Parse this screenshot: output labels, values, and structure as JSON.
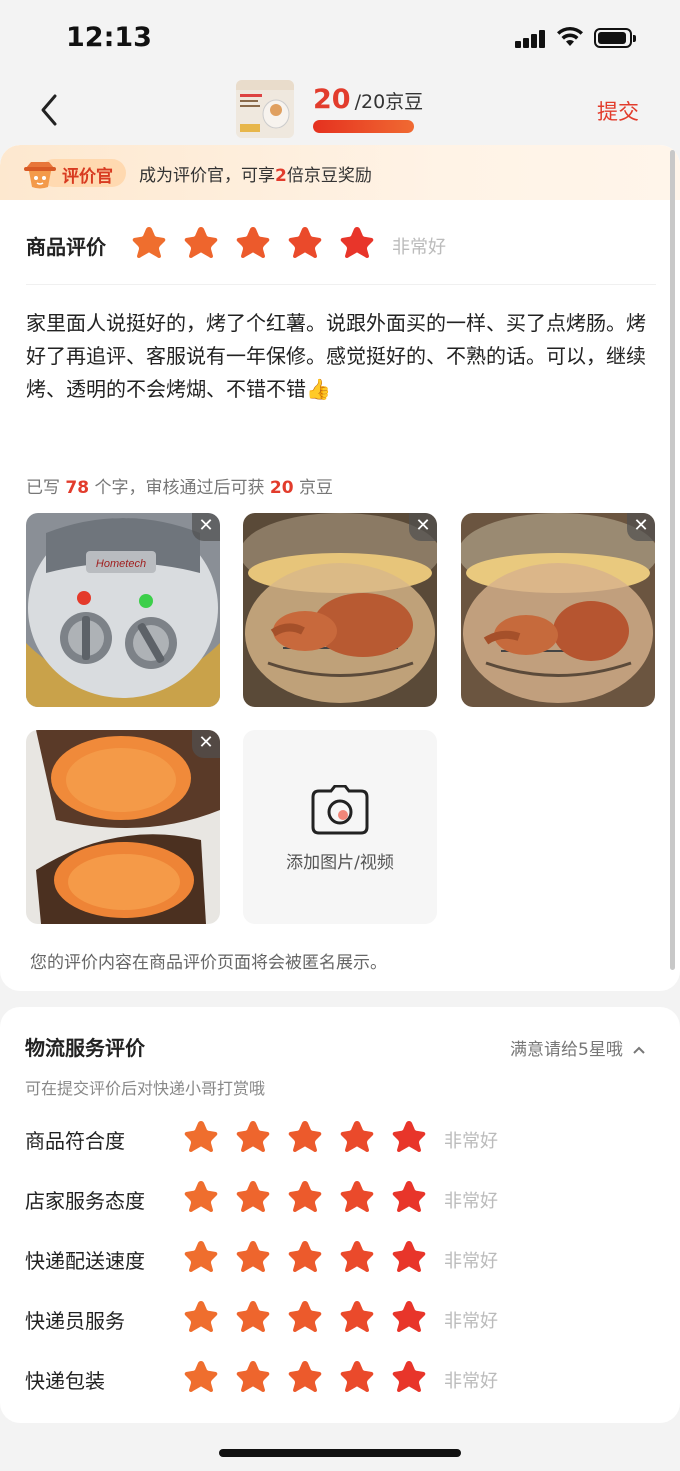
{
  "status": {
    "time": "12:13"
  },
  "nav": {
    "bean_current": "20",
    "bean_total": "/20京豆",
    "bean_progress": 1.0,
    "submit_label": "提交"
  },
  "banner": {
    "badge": "评价官",
    "text_before": "成为评价官，可享",
    "multiplier": "2",
    "text_after": "倍京豆奖励"
  },
  "product_rating": {
    "label": "商品评价",
    "stars": 5,
    "note": "非常好"
  },
  "review": {
    "text": "家里面人说挺好的，烤了个红薯。说跟外面买的一样、买了点烤肠。烤好了再追评、客服说有一年保修。感觉挺好的、不熟的话。可以，继续烤、透明的不会烤煳、不错不错👍",
    "count_prefix": "已写",
    "count": "78",
    "count_mid": "个字，审核通过后可获",
    "beans": "20",
    "count_suffix": "京豆"
  },
  "photos": [
    {
      "name": "photo-air-fryer-dials",
      "close": "✕"
    },
    {
      "name": "photo-sweet-potato-in-fryer",
      "close": "✕"
    },
    {
      "name": "photo-sweet-potato-in-fryer-2",
      "close": "✕"
    },
    {
      "name": "photo-sweet-potato-opened",
      "close": "✕"
    }
  ],
  "add_media": {
    "label": "添加图片/视频"
  },
  "anonymous_note": "您的评价内容在商品评价页面将会被匿名展示。",
  "logistics": {
    "title": "物流服务评价",
    "hint": "满意请给5星哦",
    "subtitle": "可在提交评价后对快递小哥打赏哦",
    "rows": [
      {
        "label": "商品符合度",
        "stars": 5,
        "note": "非常好"
      },
      {
        "label": "店家服务态度",
        "stars": 5,
        "note": "非常好"
      },
      {
        "label": "快递配送速度",
        "stars": 5,
        "note": "非常好"
      },
      {
        "label": "快递员服务",
        "stars": 5,
        "note": "非常好"
      },
      {
        "label": "快递包装",
        "stars": 5,
        "note": "非常好"
      }
    ]
  },
  "colors": {
    "accent": "#e23c2c",
    "star_start": "#ef6a2c",
    "star_end": "#e8322a"
  }
}
